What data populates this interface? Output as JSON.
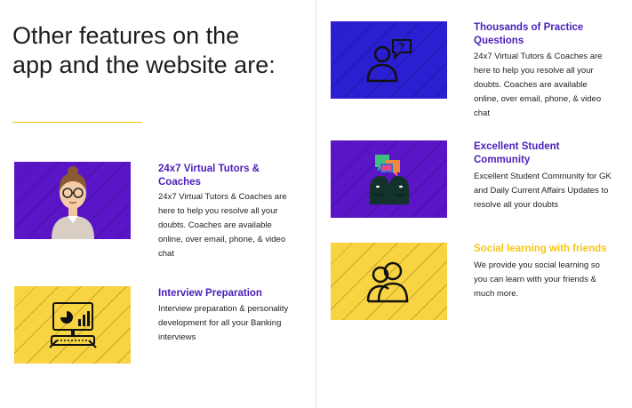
{
  "heading": "Other features on the app and the website are:",
  "features": [
    {
      "title": "24x7 Virtual Tutors & Coaches",
      "description": "24x7 Virtual Tutors & Coaches are here to help you resolve all your doubts. Coaches are available online, over email, phone, & video chat",
      "icon": "tutor-avatar-icon",
      "card_color": "#5a16c6"
    },
    {
      "title": "Interview Preparation",
      "description": "Interview preparation & personality development for all your Banking interviews",
      "icon": "computer-presentation-icon",
      "card_color": "#f8d443"
    },
    {
      "title": "Thousands of Practice Questions",
      "description": "24x7 Virtual Tutors & Coaches are here to help you resolve all your doubts. Coaches are available online, over email, phone, & video chat",
      "icon": "person-question-icon",
      "card_color": "#2a1fd1"
    },
    {
      "title": "Excellent Student Community",
      "description": "Excellent Student Community for GK and Daily Current Affairs Updates to resolve all your doubts",
      "icon": "community-chat-icon",
      "card_color": "#5a16c6"
    },
    {
      "title": "Social learning with friends",
      "description": "We provide you social learning so you can learn with your friends & much more.",
      "icon": "two-people-icon",
      "card_color": "#f8d443"
    }
  ],
  "colors": {
    "accent_purple": "#4a1fb8",
    "accent_yellow": "#f5c518",
    "underline": "#f2c400"
  }
}
